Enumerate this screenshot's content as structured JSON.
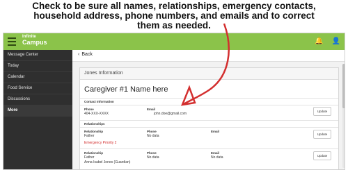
{
  "instruction": {
    "lines": [
      "Check to be sure all names, relationships, emergency contacts,",
      "household address, phone numbers, and emails and to correct",
      "them as needed."
    ]
  },
  "app": {
    "logo": {
      "line1": "Infinite",
      "line2": "Campus"
    },
    "top_icons": [
      "bell-icon",
      "person-icon"
    ]
  },
  "sidebar": {
    "items": [
      {
        "label": "Message Center"
      },
      {
        "label": "Today"
      },
      {
        "label": "Calendar"
      },
      {
        "label": "Food Service"
      },
      {
        "label": "Discussions"
      },
      {
        "label": "More"
      }
    ]
  },
  "content": {
    "back_label": "Back",
    "panel_title": "Jones Information",
    "caregiver_name": "Caregiver #1 Name here",
    "contact": {
      "section": "Contact Information",
      "phone_label": "Phone",
      "phone_value": "404-XXX-XXXX",
      "email_label": "Email",
      "email_value": "john.doe@gmail.com",
      "update_label": "Update"
    },
    "relationships": {
      "section": "Relationships",
      "rows": [
        {
          "relationship_label": "Relationship",
          "relationship": "Father",
          "extra": "Emergency Priority 2",
          "phone_label": "Phone",
          "phone": "No data",
          "email_label": "Email",
          "email": "",
          "update_label": "Update"
        },
        {
          "relationship_label": "Relationship",
          "relationship": "Father",
          "extra": "Anna Isabel Jones (Guardian)",
          "phone_label": "Phone",
          "phone": "No data",
          "email_label": "Email",
          "email": "No data",
          "update_label": "Update"
        }
      ]
    }
  },
  "colors": {
    "topbar": "#8bc34a",
    "sidebar": "#2f2f2f",
    "arrow": "#d32f2f",
    "emergency": "#d32f2f"
  }
}
